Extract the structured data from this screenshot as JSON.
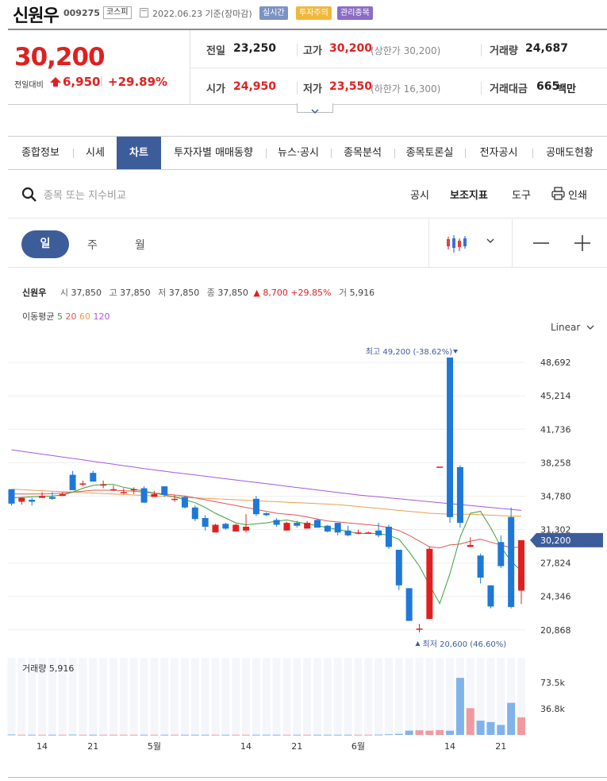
{
  "header": {
    "stock_name": "신원우",
    "stock_code": "009275",
    "market": "코스피",
    "date_text": "2022.06.23 기준(장마감)",
    "badges": [
      "실시간",
      "투자주의",
      "관리종목"
    ]
  },
  "quote": {
    "price": "30,200",
    "change_label": "전일대비",
    "change": "6,950",
    "change_pct": "+29.89%",
    "prev_close_label": "전일",
    "prev_close": "23,250",
    "high_label": "고가",
    "high": "30,200",
    "upper_limit": "(상한가 30,200)",
    "volume_label": "거래량",
    "volume": "24,687",
    "open_label": "시가",
    "open": "24,950",
    "low_label": "저가",
    "low": "23,550",
    "lower_limit": "(하한가 16,300)",
    "amount_label": "거래대금",
    "amount": "665",
    "amount_unit": "백만"
  },
  "tabs": [
    {
      "label": "종합정보",
      "active": false
    },
    {
      "label": "시세",
      "active": false
    },
    {
      "label": "차트",
      "active": true
    },
    {
      "label": "투자자별 매매동향",
      "active": false
    },
    {
      "label": "뉴스·공시",
      "active": false
    },
    {
      "label": "종목분석",
      "active": false
    },
    {
      "label": "종목토론실",
      "active": false
    },
    {
      "label": "전자공시",
      "active": false
    },
    {
      "label": "공매도현황",
      "active": false
    }
  ],
  "toolbar": {
    "search_placeholder": "종목 또는 지수비교",
    "disclosure": "공시",
    "indicator": "보조지표",
    "tools": "도구",
    "print": "인쇄"
  },
  "period": {
    "day": "일",
    "week": "주",
    "month": "월"
  },
  "ohlc_line": {
    "name": "신원우",
    "open_label": "시",
    "open": "37,850",
    "high_label": "고",
    "high": "37,850",
    "low_label": "저",
    "low": "37,850",
    "close_label": "종",
    "close": "37,850",
    "change": "▲ 8,700 +29.85%",
    "volume_label": "거",
    "volume": "5,916"
  },
  "ma_legend": {
    "label": "이동평균",
    "ma5": "5",
    "ma20": "20",
    "ma60": "60",
    "ma120": "120"
  },
  "scale": "Linear",
  "colors": {
    "up": "#e02020",
    "down": "#1e78d8",
    "accent": "#3d5d9a",
    "ma5": "#3aa13a",
    "ma20": "#e05555",
    "ma60": "#e8a050",
    "ma120": "#a55ad8"
  },
  "chart_data": {
    "type": "candlestick",
    "y_ticks": [
      "48,692",
      "45,214",
      "41,736",
      "38,258",
      "34,780",
      "31,302",
      "27,824",
      "24,346",
      "20,868"
    ],
    "y_tick_values": [
      48692,
      45214,
      41736,
      38258,
      34780,
      31302,
      27824,
      24346,
      20868
    ],
    "current_label": "30,200",
    "current_value": 30200,
    "max_label": "최고 49,200 (-38.62%)",
    "min_label": "최저 20,600 (46.60%)",
    "x_labels": [
      "14",
      "21",
      "5월",
      "14",
      "21",
      "6월",
      "14",
      "21"
    ],
    "x_label_index": [
      3,
      8,
      14,
      23,
      28,
      34,
      43,
      48
    ],
    "candles": [
      [
        35500,
        33800,
        35400,
        34000
      ],
      [
        34200,
        33900,
        34600,
        34600
      ],
      [
        34400,
        33800,
        34600,
        34200
      ],
      [
        34600,
        34600,
        35200,
        34800
      ],
      [
        34700,
        34400,
        35200,
        34500
      ],
      [
        34800,
        34800,
        35200,
        35000
      ],
      [
        37000,
        35400,
        37400,
        35400
      ],
      [
        36100,
        35800,
        36400,
        36100
      ],
      [
        37200,
        36300,
        37400,
        36300
      ],
      [
        36000,
        35600,
        36400,
        36000
      ],
      [
        35500,
        35300,
        35900,
        35500
      ],
      [
        35200,
        35000,
        35600,
        35200
      ],
      [
        35500,
        35000,
        35700,
        35500
      ],
      [
        35600,
        34100,
        35800,
        34100
      ],
      [
        34700,
        34700,
        35300,
        35000
      ],
      [
        35800,
        34700,
        35800,
        34900
      ],
      [
        34400,
        34200,
        34900,
        34500
      ],
      [
        34700,
        33500,
        34800,
        33600
      ],
      [
        33600,
        32200,
        33800,
        32400
      ],
      [
        32500,
        31200,
        32800,
        31600
      ],
      [
        31000,
        31000,
        31900,
        31800
      ],
      [
        31900,
        31300,
        32000,
        31400
      ],
      [
        31100,
        31100,
        31900,
        31800
      ],
      [
        31200,
        31000,
        32900,
        31600
      ],
      [
        34500,
        32700,
        34800,
        32900
      ],
      [
        33000,
        32700,
        33100,
        32800
      ],
      [
        32300,
        31600,
        32500,
        31800
      ],
      [
        31200,
        31200,
        32100,
        32000
      ],
      [
        32000,
        31500,
        32200,
        31700
      ],
      [
        31400,
        31400,
        32200,
        32000
      ],
      [
        32300,
        31500,
        32400,
        31500
      ],
      [
        31700,
        31000,
        31800,
        31100
      ],
      [
        32000,
        30700,
        32000,
        31000
      ],
      [
        31200,
        30600,
        31700,
        30700
      ],
      [
        30900,
        30800,
        31300,
        31000
      ],
      [
        31000,
        30900,
        31100,
        31000
      ],
      [
        31200,
        30500,
        32000,
        30700
      ],
      [
        31600,
        29300,
        31800,
        29500
      ],
      [
        29200,
        25000,
        29200,
        25500
      ],
      [
        25200,
        21800,
        25200,
        21800
      ],
      [
        21000,
        20600,
        21500,
        21000
      ],
      [
        22000,
        22000,
        29500,
        29300
      ],
      [
        37850,
        37850,
        37850,
        37850
      ],
      [
        49200,
        32000,
        49200,
        32600
      ],
      [
        37800,
        31500,
        38000,
        32000
      ],
      [
        29500,
        29500,
        30500,
        29700
      ],
      [
        28600,
        25700,
        28800,
        26300
      ],
      [
        25500,
        23100,
        25500,
        23300
      ],
      [
        30000,
        27300,
        30700,
        27500
      ],
      [
        32600,
        23100,
        33600,
        23250
      ],
      [
        24950,
        23550,
        30200,
        30200
      ]
    ],
    "ma5": [
      34600,
      34650,
      34700,
      34750,
      34800,
      34900,
      35200,
      35600,
      35900,
      36000,
      36000,
      35700,
      35500,
      35300,
      35100,
      34900,
      34700,
      34400,
      34100,
      33600,
      33000,
      32500,
      32000,
      31800,
      31900,
      32000,
      32200,
      32300,
      32100,
      31900,
      31700,
      31500,
      31300,
      31100,
      30900,
      30900,
      30900,
      30700,
      30300,
      29000,
      27500,
      25500,
      23600,
      26700,
      30500,
      33000,
      33200,
      31500,
      29500,
      28000,
      27000
    ],
    "ma20": [
      35000,
      35000,
      35000,
      35000,
      35050,
      35100,
      35200,
      35300,
      35400,
      35400,
      35400,
      35350,
      35300,
      35200,
      35100,
      35000,
      34900,
      34800,
      34600,
      34400,
      34200,
      34000,
      33800,
      33600,
      33400,
      33200,
      33000,
      32900,
      32800,
      32600,
      32400,
      32200,
      32100,
      32000,
      31900,
      31800,
      31700,
      31500,
      31200,
      30700,
      30100,
      29500,
      29400,
      29700,
      29800,
      30100,
      30300,
      30000,
      29700,
      29400,
      29500
    ],
    "ma60": [
      35500,
      35450,
      35400,
      35350,
      35300,
      35250,
      35200,
      35150,
      35100,
      35050,
      35000,
      34950,
      34900,
      34850,
      34800,
      34750,
      34700,
      34650,
      34600,
      34550,
      34500,
      34450,
      34400,
      34350,
      34300,
      34250,
      34200,
      34150,
      34100,
      34050,
      34000,
      33950,
      33900,
      33800,
      33700,
      33600,
      33500,
      33400,
      33300,
      33200,
      33100,
      33000,
      32950,
      32900,
      32900,
      32900,
      32850,
      32800,
      32750,
      32700,
      32700
    ],
    "ma120": [
      39600,
      39450,
      39300,
      39150,
      39000,
      38850,
      38700,
      38550,
      38400,
      38250,
      38100,
      37950,
      37800,
      37650,
      37500,
      37370,
      37240,
      37110,
      36980,
      36850,
      36720,
      36590,
      36460,
      36330,
      36200,
      36070,
      35940,
      35810,
      35680,
      35550,
      35420,
      35290,
      35160,
      35030,
      34900,
      34800,
      34700,
      34600,
      34500,
      34400,
      34300,
      34200,
      34100,
      34000,
      33900,
      33800,
      33700,
      33600,
      33500,
      33400,
      33300
    ],
    "volume_label": "거래량 5,916",
    "volume_ticks": [
      "73.5k",
      "36.8k"
    ],
    "volume_tick_values": [
      73500,
      36800
    ],
    "volume": [
      600,
      300,
      300,
      300,
      300,
      300,
      500,
      300,
      300,
      300,
      300,
      300,
      300,
      300,
      300,
      300,
      300,
      300,
      300,
      300,
      300,
      300,
      300,
      300,
      300,
      300,
      300,
      300,
      300,
      300,
      300,
      300,
      300,
      300,
      300,
      300,
      500,
      900,
      1500,
      6000,
      6500,
      6000,
      6800,
      5900,
      80000,
      37500,
      20000,
      18000,
      14000,
      45000,
      24687
    ]
  }
}
